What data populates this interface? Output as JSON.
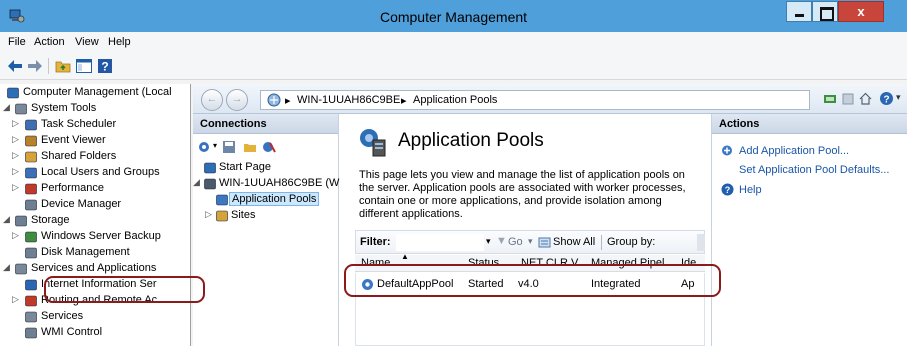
{
  "window": {
    "title": "Computer Management"
  },
  "menu": [
    "File",
    "Action",
    "View",
    "Help"
  ],
  "tree": {
    "items": [
      {
        "label": "Computer Management (Local",
        "level": 0,
        "arrow": "",
        "icon": "computer-management-icon"
      },
      {
        "label": "System Tools",
        "level": 1,
        "arrow": "◢",
        "icon": "system-tools-icon"
      },
      {
        "label": "Task Scheduler",
        "level": 2,
        "arrow": "▷",
        "icon": "task-scheduler-icon"
      },
      {
        "label": "Event Viewer",
        "level": 2,
        "arrow": "▷",
        "icon": "event-viewer-icon"
      },
      {
        "label": "Shared Folders",
        "level": 2,
        "arrow": "▷",
        "icon": "shared-folders-icon"
      },
      {
        "label": "Local Users and Groups",
        "level": 2,
        "arrow": "▷",
        "icon": "users-icon"
      },
      {
        "label": "Performance",
        "level": 2,
        "arrow": "▷",
        "icon": "performance-icon"
      },
      {
        "label": "Device Manager",
        "level": 2,
        "arrow": "",
        "icon": "device-manager-icon"
      },
      {
        "label": "Storage",
        "level": 1,
        "arrow": "◢",
        "icon": "storage-icon"
      },
      {
        "label": "Windows Server Backup",
        "level": 2,
        "arrow": "▷",
        "icon": "backup-icon"
      },
      {
        "label": "Disk Management",
        "level": 2,
        "arrow": "",
        "icon": "disk-management-icon"
      },
      {
        "label": "Services and Applications",
        "level": 1,
        "arrow": "◢",
        "icon": "services-applications-icon"
      },
      {
        "label": "Internet Information Ser",
        "level": 2,
        "arrow": "",
        "icon": "iis-icon"
      },
      {
        "label": "Routing and Remote Ac",
        "level": 2,
        "arrow": "▷",
        "icon": "routing-icon"
      },
      {
        "label": "Services",
        "level": 2,
        "arrow": "",
        "icon": "services-icon"
      },
      {
        "label": "WMI Control",
        "level": 2,
        "arrow": "",
        "icon": "wmi-icon"
      }
    ]
  },
  "address": {
    "server": "WIN-1UUAH86C9BE",
    "page": "Application Pools"
  },
  "connections": {
    "header": "Connections",
    "items": [
      {
        "label": "Start Page"
      },
      {
        "label": "WIN-1UUAH86C9BE (W"
      },
      {
        "label": "Application Pools"
      },
      {
        "label": "Sites"
      }
    ]
  },
  "center": {
    "title": "Application Pools",
    "description": "This page lets you view and manage the list of application pools on the server. Application pools are associated with worker processes, contain one or more applications, and provide isolation among different applications.",
    "filter_label": "Filter:",
    "go_label": "Go",
    "show_all_label": "Show All",
    "group_by_label": "Group by:",
    "columns": [
      "Name",
      "Status",
      ".NET CLR V...",
      "Managed Pipel...",
      "Ide"
    ],
    "rows": [
      {
        "name": "DefaultAppPool",
        "status": "Started",
        "clr": "v4.0",
        "pipeline": "Integrated",
        "identity": "Ap"
      }
    ]
  },
  "actions": {
    "header": "Actions",
    "items": [
      "Add Application Pool...",
      "Set Application Pool Defaults...",
      "Help"
    ]
  },
  "colors": {
    "titlebar": "#4f9fda",
    "close": "#c7453b",
    "link": "#1a56a8",
    "annotation": "#8b1a1a"
  }
}
